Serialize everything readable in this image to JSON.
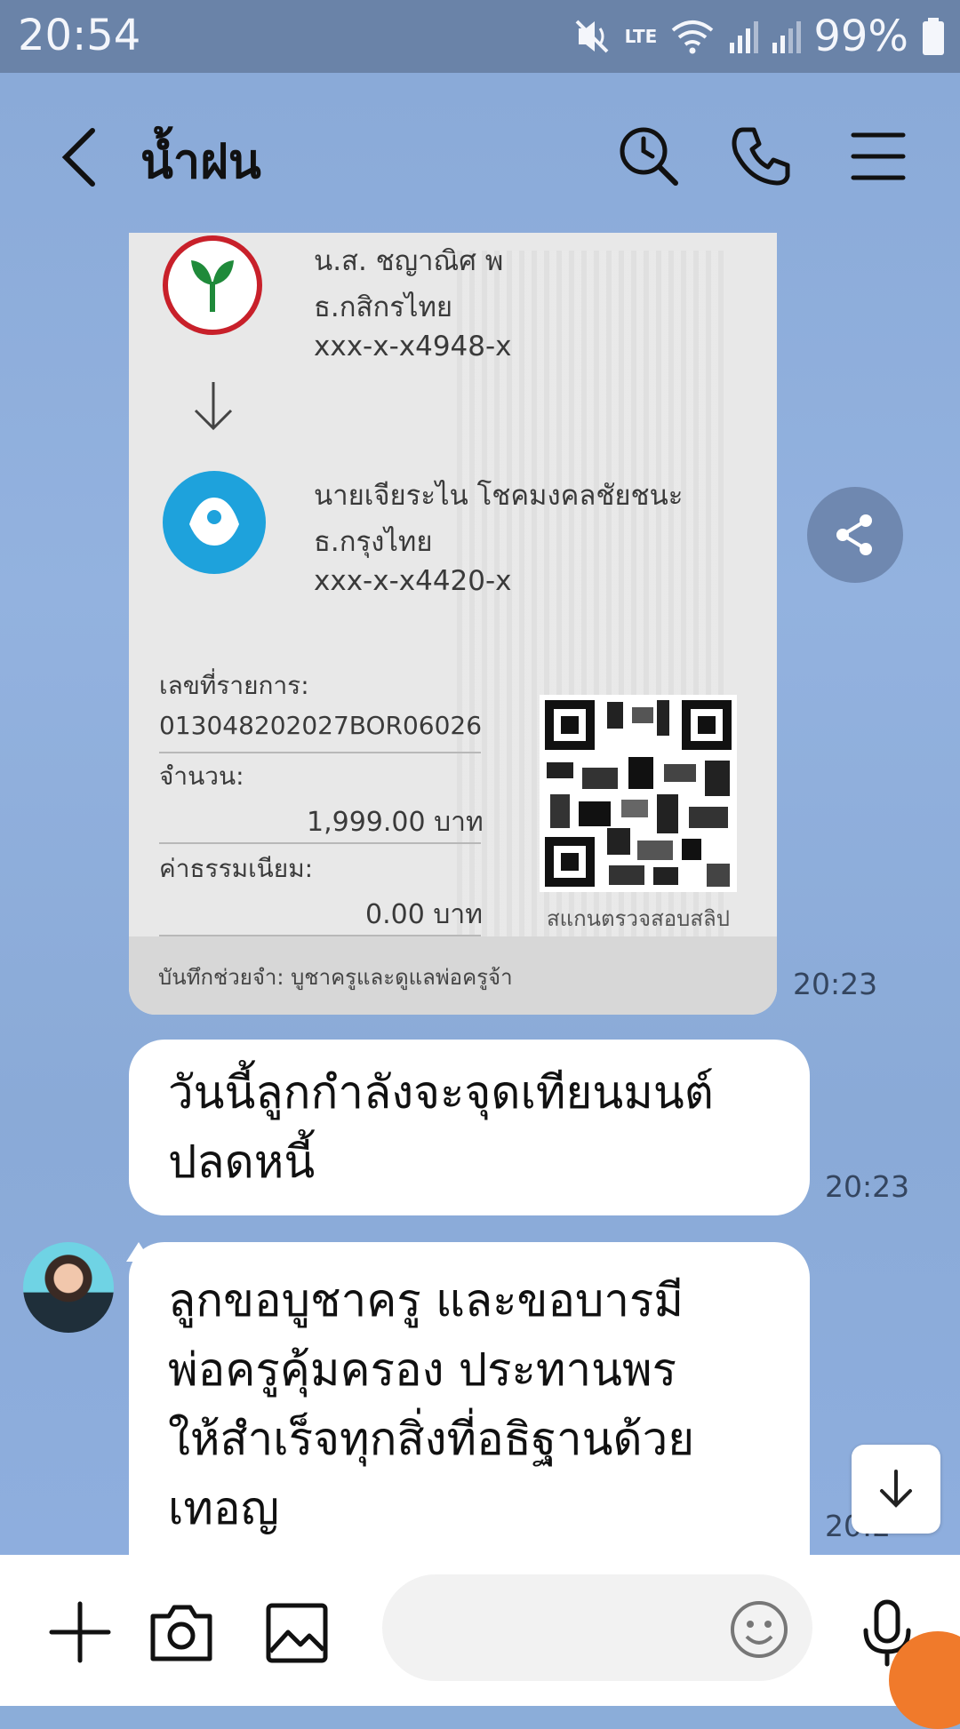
{
  "status_bar": {
    "time": "20:54",
    "battery": "99%",
    "network": "LTE"
  },
  "header": {
    "title": "น้ำฝน"
  },
  "slip": {
    "sender_name": "น.ส. ชญาณิศ พ",
    "sender_bank": "ธ.กสิกรไทย",
    "sender_account": "xxx-x-x4948-x",
    "receiver_name": "นายเจียระไน โชคมงคลชัยชนะ",
    "receiver_bank": "ธ.กรุงไทย",
    "receiver_account": "xxx-x-x4420-x",
    "ref_label": "เลขที่รายการ:",
    "ref_number": "013048202027BOR06026",
    "amount_label": "จำนวน:",
    "amount_value": "1,999.00 บาท",
    "fee_label": "ค่าธรรมเนียม:",
    "fee_value": "0.00 บาท",
    "qr_caption": "สแกนตรวจสอบสลิป",
    "memo": "บันทึกช่วยจำ: บูชาครูและดูแลพ่อครูจ้า",
    "time": "20:23"
  },
  "messages": [
    {
      "lines": [
        "วันนี้ลูกกำลังจะจุดเทียนมนต์",
        "ปลดหนี้"
      ],
      "time": "20:23"
    },
    {
      "lines": [
        "ลูกขอบูชาครู และขอบารมี",
        "พ่อครูคุ้มครอง ประทานพร",
        "ให้สำเร็จทุกสิ่งที่อธิฐานด้วย",
        "เทอญ"
      ],
      "time": "20:2"
    }
  ],
  "input": {
    "placeholder": ""
  }
}
